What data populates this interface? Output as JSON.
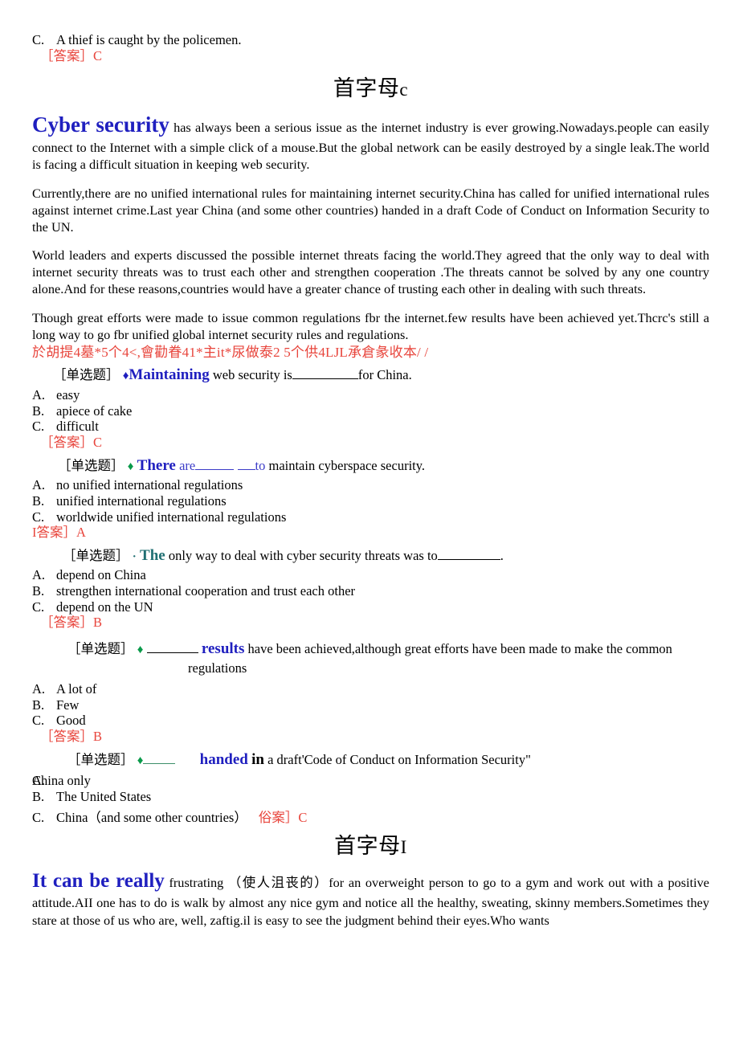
{
  "top_snippet": {
    "option_letter": "C.",
    "option_text": "A thief is caught by the policemen.",
    "answer": "［答案］C"
  },
  "section_c": {
    "title_cn": "首字母",
    "title_letter": "c",
    "passage": {
      "lead": "Cyber security",
      "p1_rest": " has always been a serious issue as the internet industry is ever growing.Nowadays.people can easily connect to the Internet with a simple click of a mouse.But the global network can be easily destroyed by a single leak.The world is facing a difficult situation in keeping web security.",
      "p2": "Currently,there are no unified international rules for maintaining internet security.China has called for unified international rules against internet crime.Last year China (and some other countries) handed in a draft Code of Conduct on Information Security to the UN.",
      "p3": "World leaders and experts discussed the possible internet threats facing the world.They agreed that the only way to deal with internet security threats was to trust each other and strengthen cooperation .The threats cannot be solved by any one country alone.And for these reasons,countries would have a greater chance of trusting each other in dealing with such threats.",
      "p4": "Though great efforts were made to issue common regulations fbr the internet.few results have been achieved yet.Thcrc's still a long way to go fbr unified global internet security rules and regulations."
    },
    "garbled_line": "於胡提4墓*5个4<,會勸眷41*主it*尿做泰2 5个供4LJL承倉彖收本/ /",
    "questions": [
      {
        "tag": "［单选题］",
        "marker": "♦",
        "marker_color": "#1f1fbf",
        "stem_bold": "Maintaining",
        "stem_bold_color": "#1f1fbf",
        "stem_mid": " web security is",
        "stem_tail": "for China.",
        "options": [
          {
            "letter": "A.",
            "text": "easy"
          },
          {
            "letter": "B.",
            "text": "apiece of cake"
          },
          {
            "letter": "C.",
            "text": "difficult"
          }
        ],
        "answer": "［答案］C"
      },
      {
        "tag": "［单选题］",
        "marker": "♦",
        "marker_color": "#0a9a4a",
        "stem_bold": "There",
        "stem_bold_color": "#1f1fbf",
        "stem_blue_word": "are",
        "stem_blue_word2": "to",
        "stem_tail": " maintain cyberspace security.",
        "options": [
          {
            "letter": "A.",
            "text": "no unified international regulations"
          },
          {
            "letter": "B.",
            "text": "unified international regulations"
          },
          {
            "letter": "C.",
            "text": "worldwide unified international regulations"
          }
        ],
        "answer": "I答案］A"
      },
      {
        "tag": "［单选题］",
        "marker": "·",
        "marker_color": "#1f6f72",
        "stem_bold": "The",
        "stem_bold_color": "#1f6f72",
        "stem_mid": " only way to deal with cyber security threats was to",
        "stem_tail": ".",
        "options": [
          {
            "letter": "A.",
            "text": "depend on China"
          },
          {
            "letter": "B.",
            "text": "strengthen international cooperation and trust each other"
          },
          {
            "letter": "C.",
            "text": "depend on the UN"
          }
        ],
        "answer": "［答案］B"
      },
      {
        "tag": "［单选题］",
        "marker": "♦",
        "marker_color": "#0a9a4a",
        "stem_bold": "results",
        "stem_bold_color": "#1f1fbf",
        "stem_mid": " have been achieved,although great efforts have been made to make the common",
        "stem_second_line": "regulations",
        "options": [
          {
            "letter": "A.",
            "text": "A lot of"
          },
          {
            "letter": "B.",
            "text": "Few"
          },
          {
            "letter": "C.",
            "text": "Good"
          }
        ],
        "answer": "［答案］B"
      },
      {
        "tag": "［单选题］",
        "marker": "♦",
        "marker_color": "#0a9a4a",
        "stem_bold": "handed",
        "stem_bold_color": "#1f1fbf",
        "stem_bold_black": "in",
        "stem_mid": " a draft'Code of Conduct on Information Security\"",
        "options": [
          {
            "letter": "A.",
            "text": "China only",
            "tight": true
          },
          {
            "letter": "B.",
            "text": "The United States"
          },
          {
            "letter": "C.",
            "text": "China（and some other countries）"
          }
        ],
        "answer": "俗案］C"
      }
    ]
  },
  "section_i": {
    "title_cn": "首字母",
    "title_letter": "I",
    "lead": "It can be really",
    "body": " frustrating （使人沮丧的）for an overweight person to go to a gym and work out with a positive attitude.AII one has to do is walk by almost any nice gym and notice all the healthy, sweating, skinny members.Sometimes they stare at those of us who are, well, zaftig.il is easy to see the judgment behind their eyes.Who wants"
  }
}
